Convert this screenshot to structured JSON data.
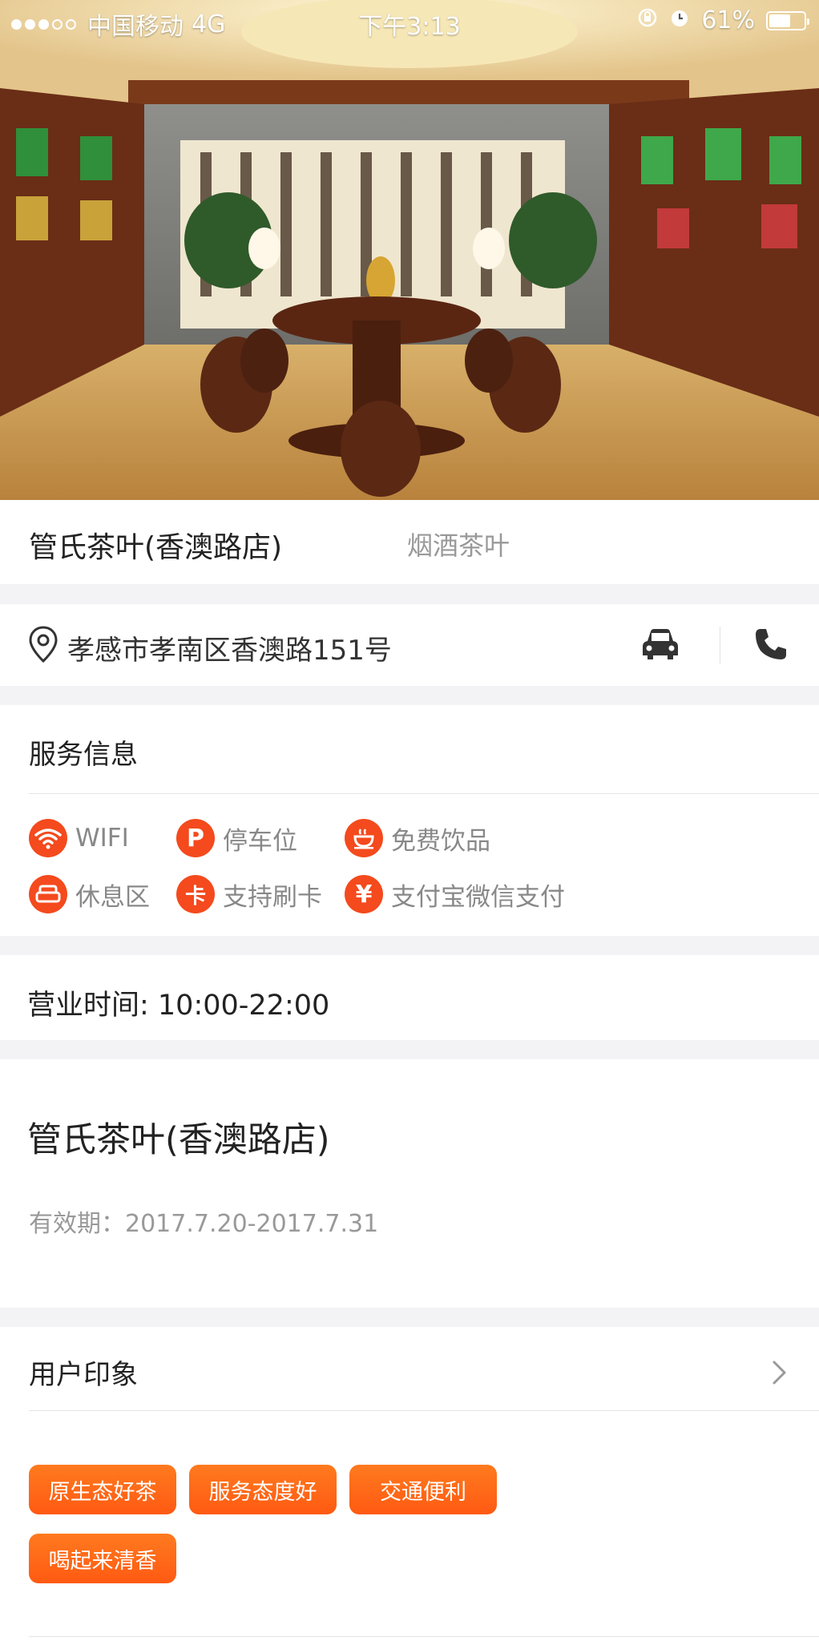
{
  "status_bar": {
    "carrier": "中国移动",
    "network": "4G",
    "time": "下午3:13",
    "battery": "61%",
    "battery_level": 0.61
  },
  "shop": {
    "name": "管氏茶叶(香澳路店)",
    "category": "烟酒茶叶",
    "address": "孝感市孝南区香澳路151号"
  },
  "icons": {
    "location": "map-pin-icon",
    "navigate": "car-icon",
    "call": "phone-icon",
    "more": "chevron-right-icon"
  },
  "service": {
    "title": "服务信息",
    "items": [
      {
        "label": "WIFI",
        "icon": "wifi-icon"
      },
      {
        "label": "停车位",
        "icon": "parking-icon",
        "glyph": "P"
      },
      {
        "label": "免费饮品",
        "icon": "drink-cup-icon"
      },
      {
        "label": "休息区",
        "icon": "sofa-icon"
      },
      {
        "label": "支持刷卡",
        "icon": "card-icon",
        "glyph": "卡"
      },
      {
        "label": "支付宝微信支付",
        "icon": "yuan-icon",
        "glyph": "¥"
      }
    ]
  },
  "hours": {
    "text": "营业时间: 10:00-22:00"
  },
  "coupon": {
    "title": "管氏茶叶(香澳路店)",
    "validity": "有效期：2017.7.20-2017.7.31"
  },
  "impressions": {
    "title": "用户印象",
    "tags": [
      "原生态好茶",
      "服务态度好",
      "交通便利",
      "喝起来清香"
    ]
  },
  "colors": {
    "accent_red": "#f44a1d",
    "tag_orange": "#ff6a16",
    "background_gray": "#f3f3f6"
  }
}
